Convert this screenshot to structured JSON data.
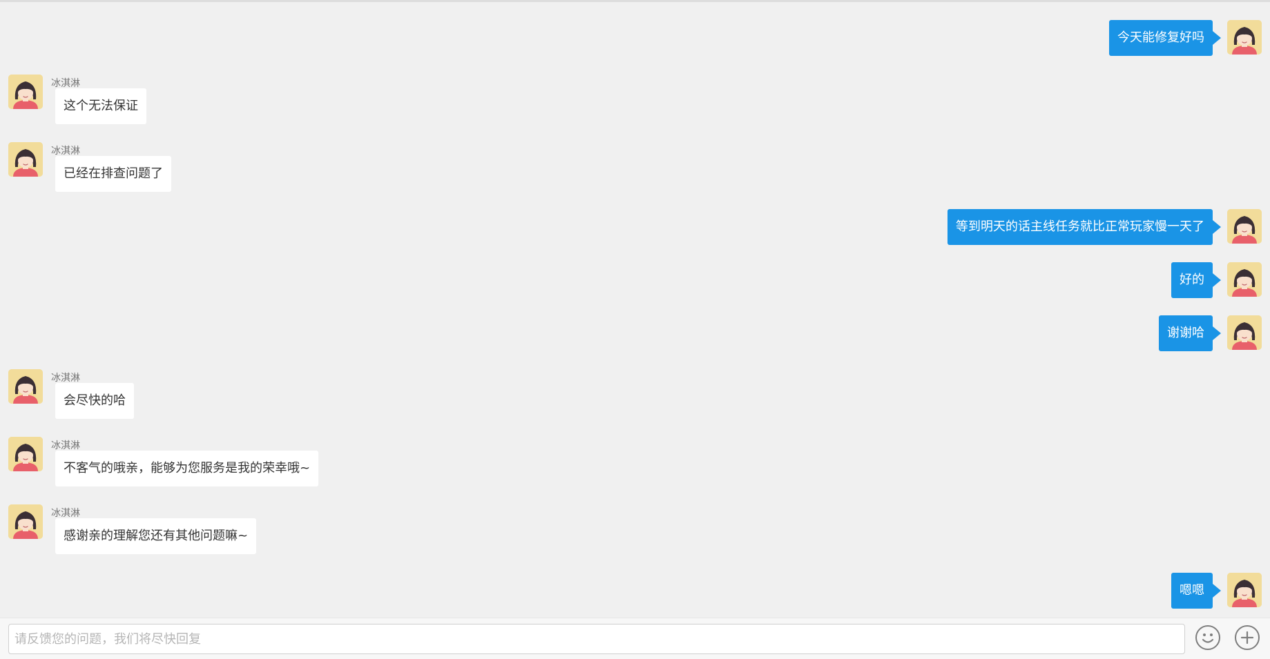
{
  "colors": {
    "background": "#f0f0f0",
    "self_bubble": "#1a94e6",
    "other_bubble": "#ffffff",
    "avatar_bg": "#f2dc9a"
  },
  "messages": [
    {
      "side": "right",
      "text": "今天能修复好吗",
      "avatar": "girl-avatar-icon"
    },
    {
      "side": "left",
      "sender": "冰淇淋",
      "text": "这个无法保证",
      "avatar": "girl-avatar-icon"
    },
    {
      "side": "left",
      "sender": "冰淇淋",
      "text": "已经在排查问题了",
      "avatar": "girl-avatar-icon"
    },
    {
      "side": "right",
      "text": "等到明天的话主线任务就比正常玩家慢一天了",
      "avatar": "girl-avatar-icon"
    },
    {
      "side": "right",
      "text": "好的",
      "avatar": "girl-avatar-icon"
    },
    {
      "side": "right",
      "text": "谢谢哈",
      "avatar": "girl-avatar-icon"
    },
    {
      "side": "left",
      "sender": "冰淇淋",
      "text": "会尽快的哈",
      "avatar": "girl-avatar-icon"
    },
    {
      "side": "left",
      "sender": "冰淇淋",
      "text": "不客气的哦亲，能够为您服务是我的荣幸哦~",
      "avatar": "girl-avatar-icon"
    },
    {
      "side": "left",
      "sender": "冰淇淋",
      "text": "感谢亲的理解您还有其他问题嘛~",
      "avatar": "girl-avatar-icon"
    },
    {
      "side": "right",
      "text": "嗯嗯",
      "avatar": "girl-avatar-icon"
    }
  ],
  "input": {
    "placeholder": "请反馈您的问题，我们将尽快回复",
    "value": ""
  },
  "buttons": {
    "emoji_icon": "smiley-face-icon",
    "add_icon": "plus-icon"
  }
}
